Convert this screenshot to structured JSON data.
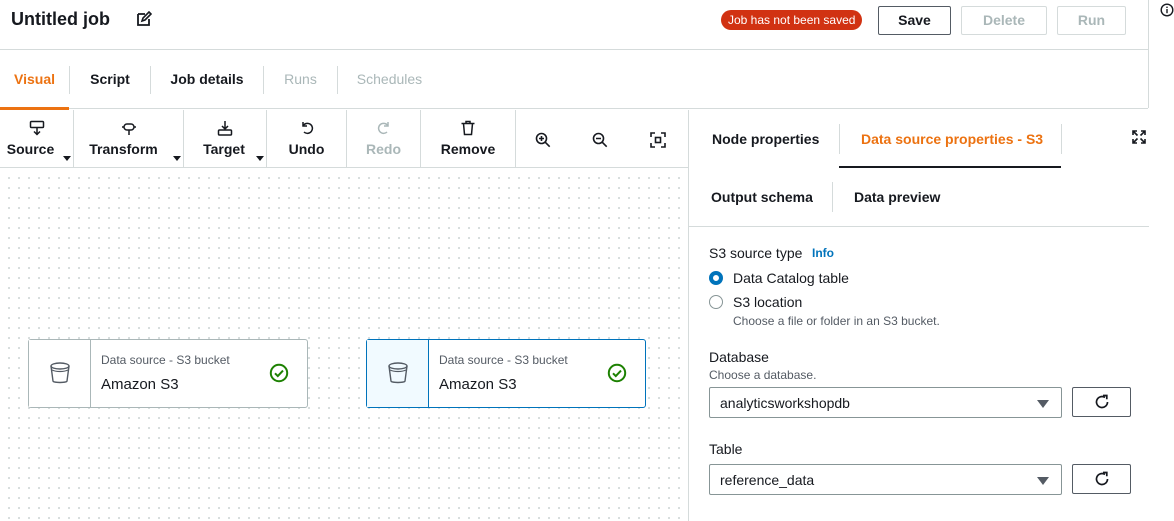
{
  "header": {
    "title": "Untitled job",
    "status_badge": "Job has not been saved",
    "save_label": "Save",
    "delete_label": "Delete",
    "run_label": "Run",
    "badge_color": "#d13212"
  },
  "tabs": [
    {
      "label": "Visual",
      "active": true
    },
    {
      "label": "Script"
    },
    {
      "label": "Job details"
    },
    {
      "label": "Runs",
      "disabled": true
    },
    {
      "label": "Schedules",
      "disabled": true
    }
  ],
  "toolbar": {
    "source": "Source",
    "transform": "Transform",
    "target": "Target",
    "undo": "Undo",
    "redo": "Redo",
    "remove": "Remove"
  },
  "canvas": {
    "nodes": [
      {
        "type": "Data source - S3 bucket",
        "name": "Amazon S3",
        "selected": false
      },
      {
        "type": "Data source - S3 bucket",
        "name": "Amazon S3",
        "selected": true
      }
    ]
  },
  "panel": {
    "tabs": [
      {
        "label": "Node properties"
      },
      {
        "label": "Data source properties - S3",
        "active": true
      },
      {
        "label": "Output schema"
      },
      {
        "label": "Data preview"
      }
    ],
    "s3_source_type_label": "S3 source type",
    "info_label": "Info",
    "options": [
      {
        "label": "Data Catalog table",
        "checked": true
      },
      {
        "label": "S3 location",
        "checked": false,
        "hint": "Choose a file or folder in an S3 bucket."
      }
    ],
    "database_label": "Database",
    "database_hint": "Choose a database.",
    "database_value": "analyticsworkshopdb",
    "table_label": "Table",
    "table_value": "reference_data"
  },
  "colors": {
    "accent": "#ec7211",
    "link": "#0073bb",
    "success": "#1d8102"
  }
}
